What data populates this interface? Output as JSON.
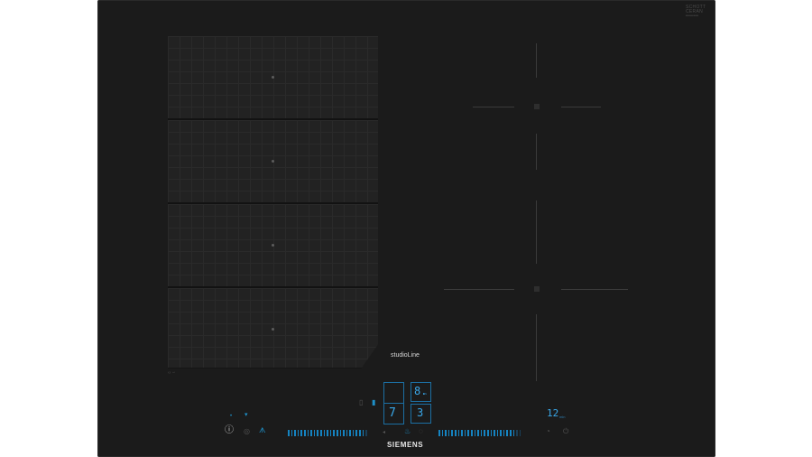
{
  "header": {
    "top_center_text": "",
    "top_right_logo_line1": "SCHOTT",
    "top_right_logo_line2": "CERAN",
    "top_right_logo_line3": "•••••••"
  },
  "zones": {
    "left_flex_zone_count": 4
  },
  "labels": {
    "series": "studioLine",
    "brand": "SIEMENS",
    "small_left_marks": "‹› ◦▫"
  },
  "controls": {
    "power_icon": "ⓘ",
    "left_indicator_dots": [
      "•",
      "▾"
    ],
    "display_left_top": "",
    "display_left_bottom": "7",
    "display_right_top": "8.",
    "display_right_top_sub": "s",
    "display_right_bottom": "3",
    "display_timer": "12",
    "display_timer_unit": "min"
  },
  "colors": {
    "glass": "#1b1b1b",
    "accent": "#1e90c8",
    "text": "#e6e6e6"
  },
  "icons": {
    "power": "power-icon",
    "fan": "fan-icon",
    "lock": "child-lock-icon",
    "timer": "timer-icon",
    "flame": "powerboost-icon"
  }
}
